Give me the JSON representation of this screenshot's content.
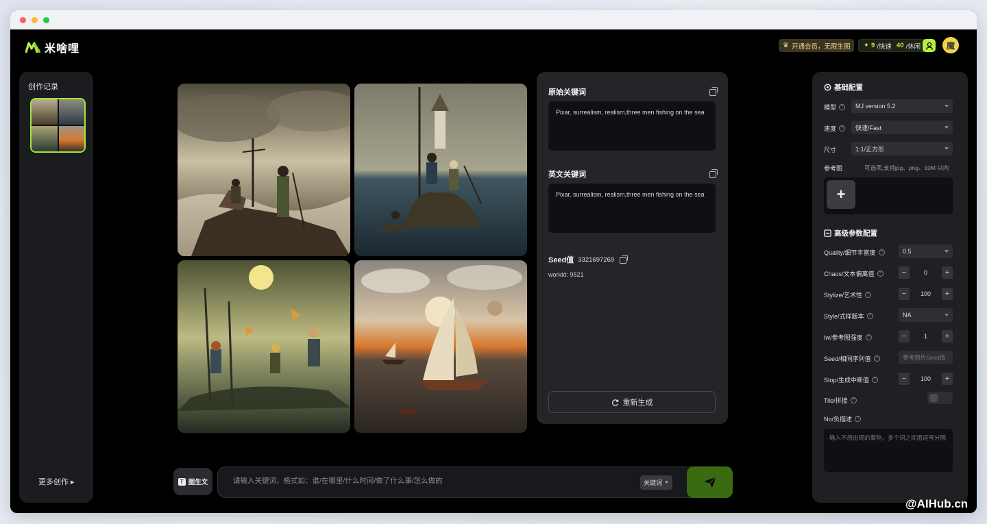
{
  "header": {
    "brand": "米啥哩",
    "vip_label": "开通会员，无限生图",
    "credits_fast_num": "9",
    "credits_fast_label": "/快速",
    "credits_idle_num": "40",
    "credits_idle_label": "/休闲",
    "avatar_text": "魔"
  },
  "sidebar": {
    "title": "创作记录",
    "more": "更多创作 ▸"
  },
  "info": {
    "orig_title": "原始关键词",
    "orig_text": "Pixar, surrealism, realism,three men fishing on the sea",
    "en_title": "英文关键词",
    "en_text": "Pixar, surrealism, realism,three men fishing on the sea",
    "seed_label": "Seed值",
    "seed_value": "3321697269",
    "work_id": "workId: 9521",
    "regen": "重新生成"
  },
  "input_bar": {
    "img2txt": "图生文",
    "placeholder": "请输入关键词，格式如：谁/在哪里/什么时间/做了什么事/怎么做的",
    "mode": "关键词"
  },
  "config": {
    "basic_title": "基础配置",
    "model_label": "模型",
    "model_value": "MJ version 5.2",
    "speed_label": "速度",
    "speed_value": "快速/Fast",
    "size_label": "尺寸",
    "size_value": "1:1/正方形",
    "ref_label": "参考图",
    "ref_hint": "可选项,支持jpg、png、10M 以内",
    "adv_title": "高级参数配置",
    "quality_label": "Quality/细节丰富度",
    "quality_value": "0.5",
    "chaos_label": "Chaos/文本偏离值",
    "chaos_value": "0",
    "stylize_label": "Stylize/艺术性",
    "stylize_value": "100",
    "style_label": "Style/式样版本",
    "style_value": "NA",
    "iw_label": "Iw/参考图强度",
    "iw_value": "1",
    "seed_label": "Seed/相同序列值",
    "seed_placeholder": "参考图片Seed值",
    "stop_label": "Stop/生成中断值",
    "stop_value": "100",
    "tile_label": "Tile/拼接",
    "no_label": "No/负描述",
    "no_placeholder": "输入不想出现的事物，多个词之间用逗号分隔"
  },
  "watermark": "@AIHub.cn"
}
